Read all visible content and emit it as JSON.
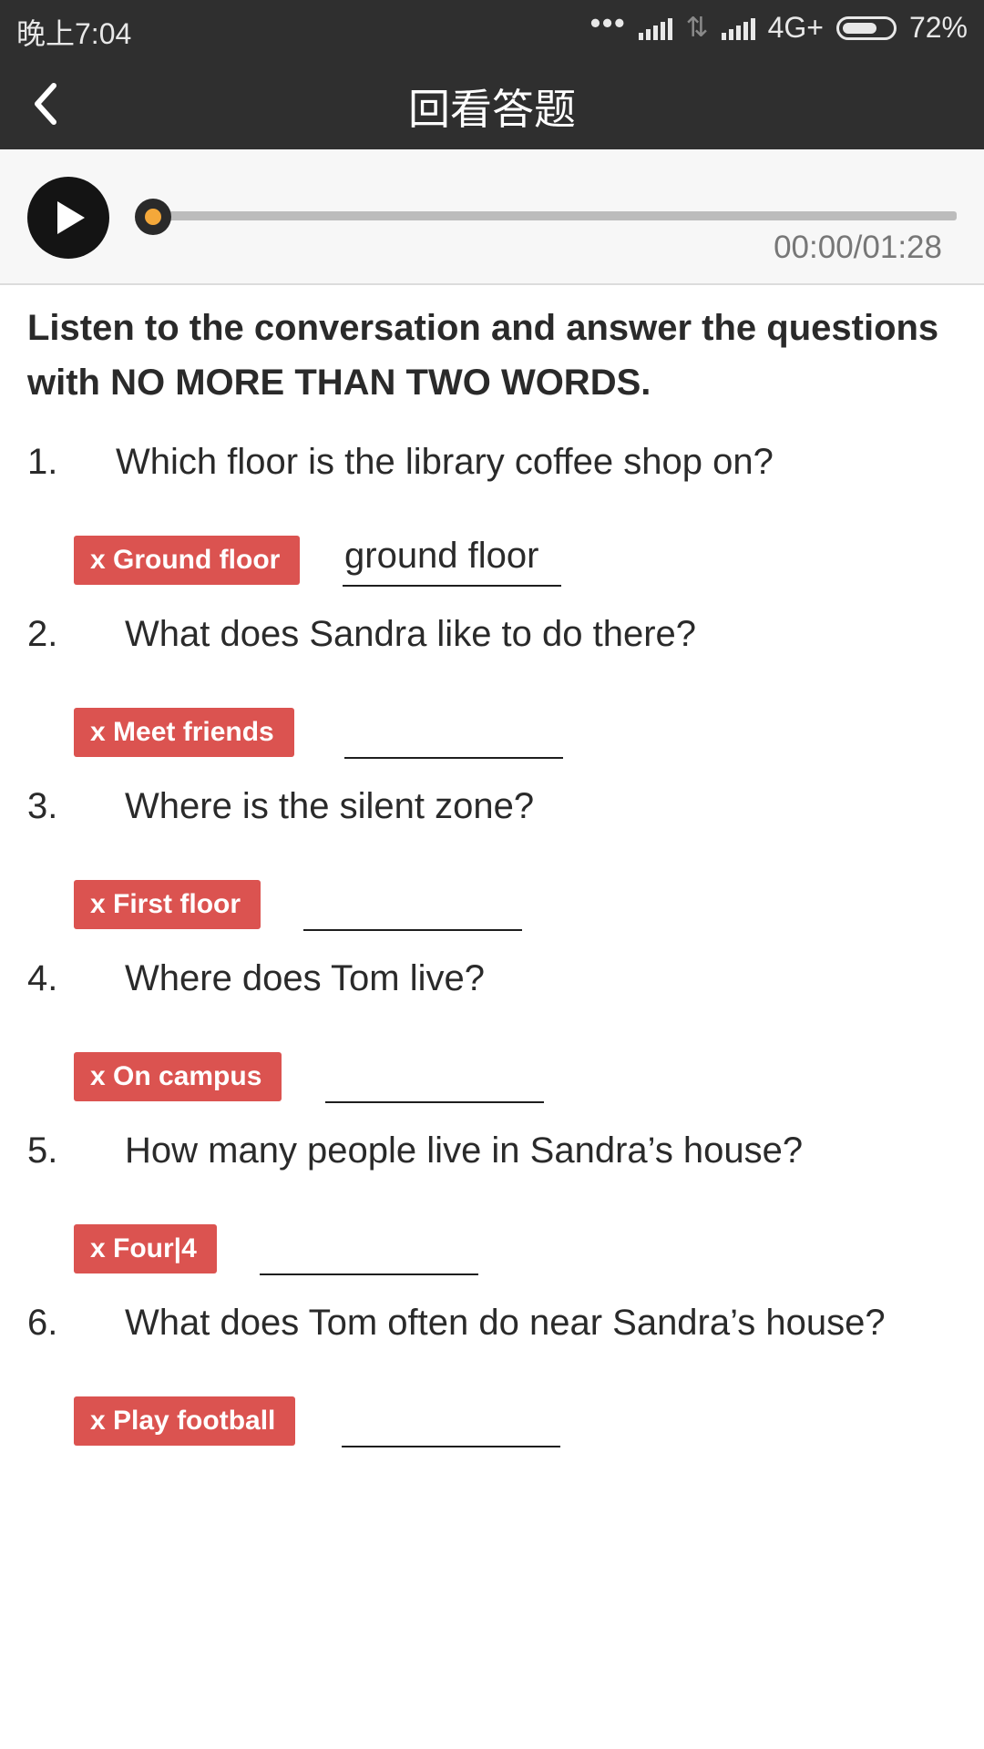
{
  "status_bar": {
    "time": "晚上7:04",
    "network": "4G+",
    "battery": "72%",
    "battery_level": 0.72,
    "icons": [
      "more-dots-icon",
      "signal-icon",
      "data-arrows-icon",
      "signal-icon",
      "battery-icon"
    ]
  },
  "app_bar": {
    "title": "回看答题",
    "back_icon": "chevron-left-icon"
  },
  "player": {
    "play_icon": "play-icon",
    "time": "00:00/01:28",
    "progress": 0.0
  },
  "instruction": "Listen to the conversation and answer the questions with NO MORE THAN TWO WORDS.",
  "questions": [
    {
      "number": "1.",
      "text": "Which floor is the library coffee shop on?",
      "correct": "x Ground floor",
      "user_answer": "ground floor"
    },
    {
      "number": "2.",
      "text": "What does Sandra like to do there?",
      "correct": "x Meet friends",
      "user_answer": ""
    },
    {
      "number": "3.",
      "text": "Where is the silent zone?",
      "correct": "x First floor",
      "user_answer": ""
    },
    {
      "number": "4.",
      "text": "Where does Tom live?",
      "correct": "x On campus",
      "user_answer": ""
    },
    {
      "number": "5.",
      "text": "How many people live in Sandra’s house?",
      "correct": "x Four|4",
      "user_answer": ""
    },
    {
      "number": "6.",
      "text": "What does Tom often do near Sandra’s house?",
      "correct": "x Play football",
      "user_answer": ""
    }
  ],
  "colors": {
    "header_bg": "#2f2f2f",
    "badge_red": "#db5350",
    "accent_orange": "#f4a83a"
  }
}
